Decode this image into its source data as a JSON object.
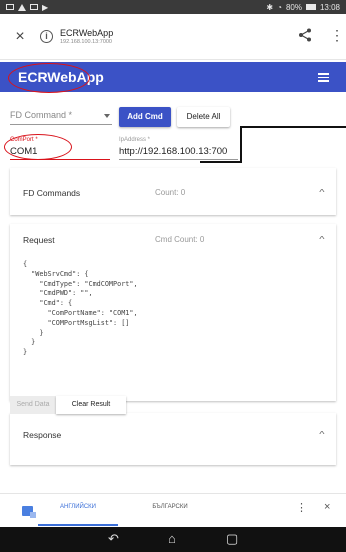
{
  "status_bar": {
    "right_text": "80%",
    "time": "13:08"
  },
  "browser": {
    "title": "ECRWebApp",
    "url": "192.168.100.13:7000",
    "close_glyph": "×",
    "menu_glyph": "⋮"
  },
  "app": {
    "brand": "ECRWebApp"
  },
  "form": {
    "fd_command_placeholder": "FD Command *",
    "add_cmd_label": "Add Cmd",
    "delete_all_label": "Delete All",
    "com_port_label": "ComPort *",
    "com_port_value": "COM1",
    "ip_label": "IpAddress *",
    "ip_value": "http://192.168.100.13:700"
  },
  "panels": {
    "fd_commands": {
      "title": "FD Commands",
      "count": "Count: 0"
    },
    "request": {
      "title": "Request",
      "count": "Cmd Count: 0"
    },
    "response": {
      "title": "Response"
    }
  },
  "request_code": "{\n  \"WebSrvCmd\": {\n    \"CmdType\": \"CmdCOMPort\",\n    \"CmdPWD\": \"\",\n    \"Cmd\": {\n      \"ComPortName\": \"COM1\",\n      \"COMPortMsgList\": []\n    }\n  }\n}",
  "actions": {
    "send_data_label": "Send Data",
    "clear_result_label": "Clear Result"
  },
  "translate_bar": {
    "lang_active": "АНГЛИЙСКИ",
    "lang_other": "БЪЛГАРСКИ",
    "menu_glyph": "⋮",
    "close_glyph": "×"
  },
  "nav": {
    "back_glyph": "↶",
    "home_glyph": "⌂",
    "recents_glyph": "▢"
  },
  "colors": {
    "brand": "#3b52c6",
    "annotation": "#d9131b"
  }
}
